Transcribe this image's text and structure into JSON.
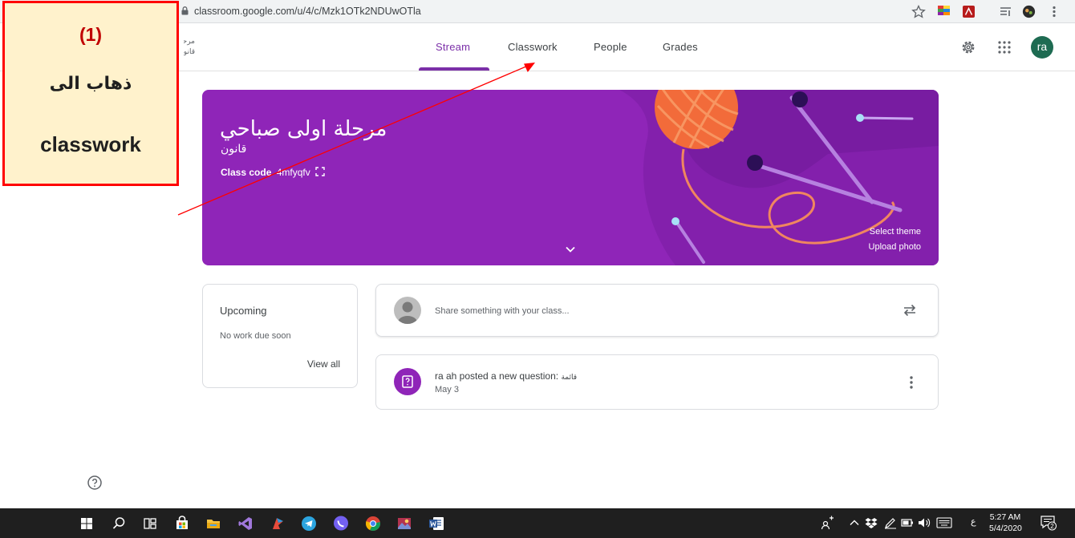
{
  "browser": {
    "url": "classroom.google.com/u/4/c/Mzk1OTk2NDUwOTla"
  },
  "header": {
    "class_name_line1": "مرحلة اولى صباحي",
    "class_name_line2": "قانون",
    "tabs": [
      {
        "label": "Stream",
        "active": true
      },
      {
        "label": "Classwork",
        "active": false
      },
      {
        "label": "People",
        "active": false
      },
      {
        "label": "Grades",
        "active": false
      }
    ],
    "avatar_initials": "ra",
    "icons": [
      "settings-icon",
      "apps-grid-icon",
      "account-avatar"
    ]
  },
  "banner": {
    "title": "مرحلة اولى صباحي",
    "subtitle": "قانون",
    "class_code_label": "Class code",
    "class_code": "4mfyqfv",
    "select_theme": "Select theme",
    "upload_photo": "Upload photo",
    "color": "#8f25b8"
  },
  "upcoming": {
    "heading": "Upcoming",
    "no_work": "No work due soon",
    "view_all": "View all"
  },
  "share": {
    "placeholder": "Share something with your class..."
  },
  "post": {
    "text": "ra ah posted a new question:",
    "question": "قائمة",
    "date": "May 3"
  },
  "annotation": {
    "number": "(1)",
    "arabic": "ذهاب الى",
    "english": "classwork",
    "border_color": "#ff0000",
    "fill_color": "#fff2cc"
  },
  "taskbar": {
    "time": "5:27 AM",
    "date": "5/4/2020",
    "language": "ع",
    "notification_count": "2"
  }
}
